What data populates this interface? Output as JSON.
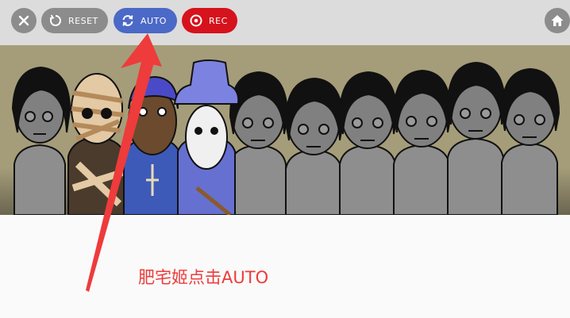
{
  "toolbar": {
    "close_icon": "close-icon",
    "reset": {
      "label": "RESET",
      "icon": "reset-icon",
      "color": "#8c8c8c"
    },
    "auto": {
      "label": "AUTO",
      "icon": "auto-refresh-icon",
      "color": "#4b69c6"
    },
    "rec": {
      "label": "REC",
      "icon": "record-icon",
      "color": "#d6121c"
    },
    "home_icon": "home-icon"
  },
  "stage": {
    "character_count": 10,
    "background_color": "#a59d79"
  },
  "annotation": {
    "caption": "肥宅姬点击AUTO",
    "arrow_color": "#ee3b3b"
  }
}
